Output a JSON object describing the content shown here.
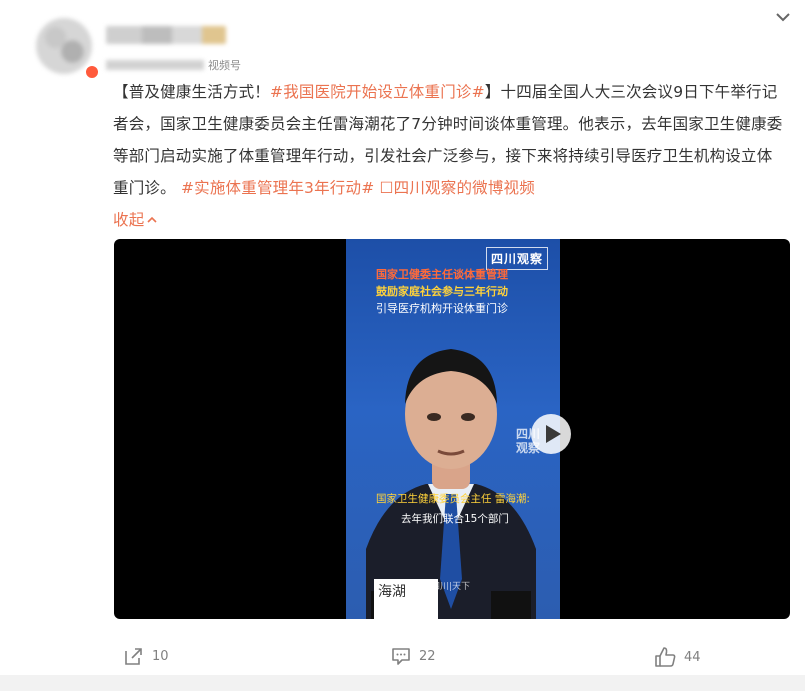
{
  "post": {
    "meta_text": "视频号",
    "segments": {
      "t1": "【普及健康生活方式！",
      "tag1": "#我国医院开始设立体重门诊#",
      "t2": "】十四届全国人大三次会议9日下午举行记者会，国家卫生健康委员会主任雷海潮花了7分钟时间谈体重管理。他表示，去年国家卫生健康委等部门启动实施了体重管理年行动，引发社会广泛参与，接下来将持续引导医疗卫生机构设立体重门诊。",
      "tag2": "#实施体重管理年3年行动#",
      "link_icon": "☐",
      "link": "四川观察的微博视频"
    },
    "collapse_label": "收起",
    "collapse_icon": "chevron-up-icon"
  },
  "video": {
    "brand": "四川观察",
    "caption_line1": "国家卫健委主任谈体重管理",
    "caption_line2": "鼓励家庭社会参与三年行动",
    "caption_line3": "引导医疗机构开设体重门诊",
    "watermark": "四川观察",
    "subtitle_speaker": "国家卫生健康委员会主任 雷海潮:",
    "subtitle_text": "去年我们联合15个部门",
    "nameplate": "海湖",
    "bottom_logo": "四川|天下",
    "play_icon": "play-icon"
  },
  "actions": {
    "share_count": "10",
    "comment_count": "22",
    "like_count": "44"
  },
  "colors": {
    "accent": "#eb7350",
    "text": "#333333",
    "muted": "#808080"
  }
}
